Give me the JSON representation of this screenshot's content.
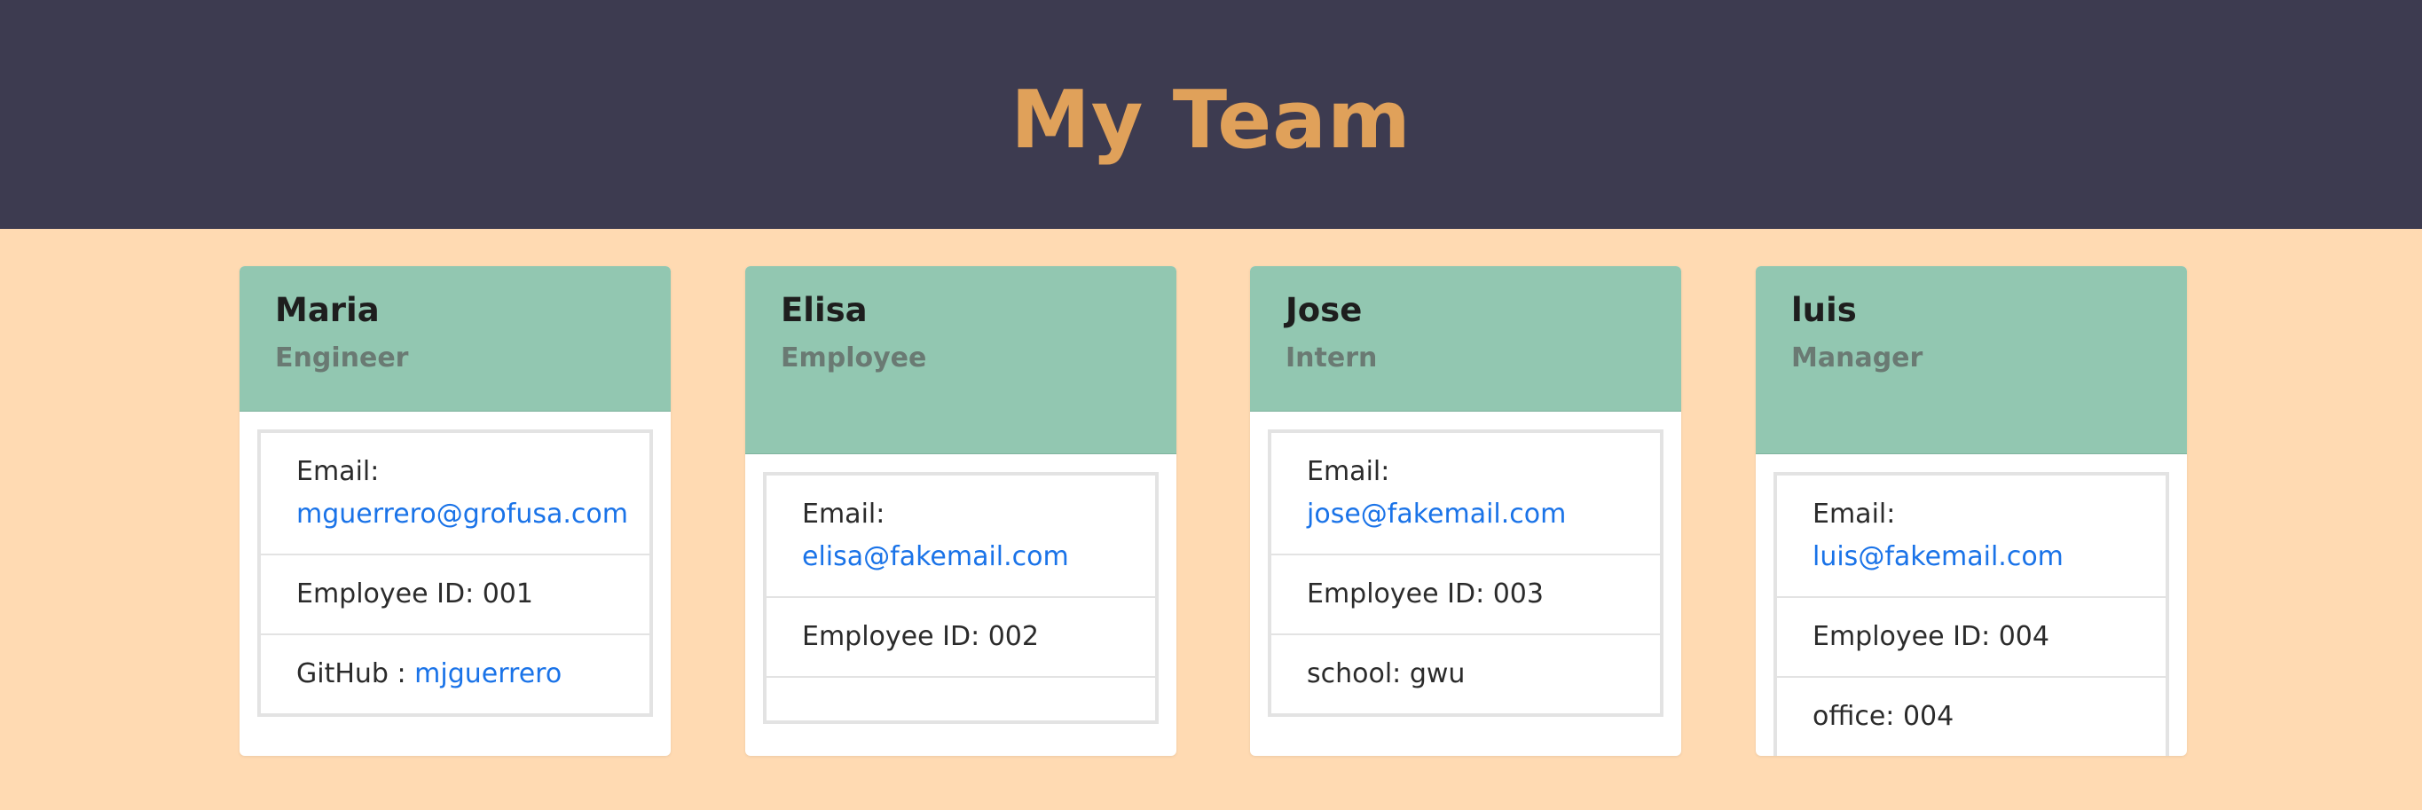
{
  "page": {
    "title": "My Team"
  },
  "colors": {
    "header_bg": "#3d3b50",
    "title": "#e0a15a",
    "page_bg": "#ffdab2",
    "card_header": "#92c7b1",
    "link": "#1a73e8"
  },
  "cards": [
    {
      "name": "Maria",
      "role": "Engineer",
      "email_label": "Email:",
      "email": "mguerrero@grofusa.com",
      "id_text": "Employee ID: 001",
      "extra_label": "GitHub :",
      "extra_value": "mjguerrero"
    },
    {
      "name": "Elisa",
      "role": "Employee",
      "email_label": "Email:",
      "email": "elisa@fakemail.com",
      "id_text": "Employee ID: 002"
    },
    {
      "name": "Jose",
      "role": "Intern",
      "email_label": "Email:",
      "email": "jose@fakemail.com",
      "id_text": "Employee ID: 003",
      "extra_text": "school: gwu"
    },
    {
      "name": "luis",
      "role": "Manager",
      "email_label": "Email:",
      "email": "luis@fakemail.com",
      "id_text": "Employee ID: 004",
      "extra_text": "office: 004"
    }
  ]
}
